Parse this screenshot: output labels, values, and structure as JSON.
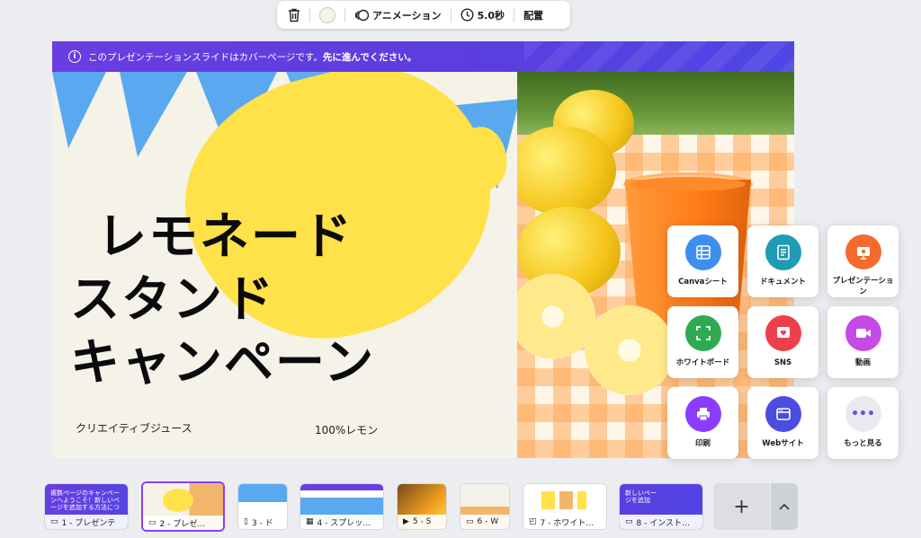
{
  "toolbar": {
    "delete_icon": "trash-icon",
    "swatch_color": "#f5f2e8",
    "animation_label": "アニメーション",
    "duration_label": "5.0秒",
    "arrange_label": "配置"
  },
  "slide": {
    "banner_text": "このプレゼンテーションスライドはカバーページです。",
    "banner_bold": "先に進んでください。",
    "headline_1": "レモネード",
    "headline_2": "スタンド",
    "headline_3": "キャンペーン",
    "subtext_left": "クリエイティブジュース",
    "subtext_right": "100%レモン",
    "colors": {
      "background": "#f5f2e8",
      "lemon": "#ffe14a",
      "bunting": "#5aa9f0",
      "banner": "#6a3de2"
    }
  },
  "panel": {
    "items": [
      {
        "label": "Canvaシート",
        "icon": "grid-sheet-icon",
        "color": "#3e8ef0"
      },
      {
        "label": "ドキュメント",
        "icon": "document-icon",
        "color": "#1f9bb5"
      },
      {
        "label": "プレゼンテーション",
        "icon": "presentation-icon",
        "color": "#f36c2b"
      },
      {
        "label": "ホワイトボード",
        "icon": "whiteboard-icon",
        "color": "#2faa51"
      },
      {
        "label": "SNS",
        "icon": "heart-icon",
        "color": "#ee3f4c"
      },
      {
        "label": "動画",
        "icon": "video-icon",
        "color": "#c64ae6"
      },
      {
        "label": "印刷",
        "icon": "printer-icon",
        "color": "#8b3dff"
      },
      {
        "label": "Webサイト",
        "icon": "website-icon",
        "color": "#4b4ce0"
      },
      {
        "label": "もっと見る",
        "icon": "more-icon",
        "color": "#e9eaf0"
      }
    ]
  },
  "filmstrip": {
    "thumbs": [
      {
        "label": "1 - プレゼンテ",
        "icon": "presentation-icon"
      },
      {
        "label": "2 - プレゼ…",
        "icon": "presentation-icon"
      },
      {
        "label": "3 - ド",
        "icon": "document-icon"
      },
      {
        "label": "4 - スプレッ…",
        "icon": "sheet-icon"
      },
      {
        "label": "5 - S",
        "icon": "video-icon"
      },
      {
        "label": "6 - W",
        "icon": "website-icon"
      },
      {
        "label": "7 - ホワイト…",
        "icon": "whiteboard-icon"
      },
      {
        "label": "8 - インスト…",
        "icon": "presentation-icon"
      }
    ],
    "thumb1_text": "複数ページのキャンペーンへようこそ！新しいページを追加する方法について、最後まで進んでください。",
    "thumb8_text": "新しいページを追加",
    "add_label": "+",
    "expand_label": "⌃"
  }
}
